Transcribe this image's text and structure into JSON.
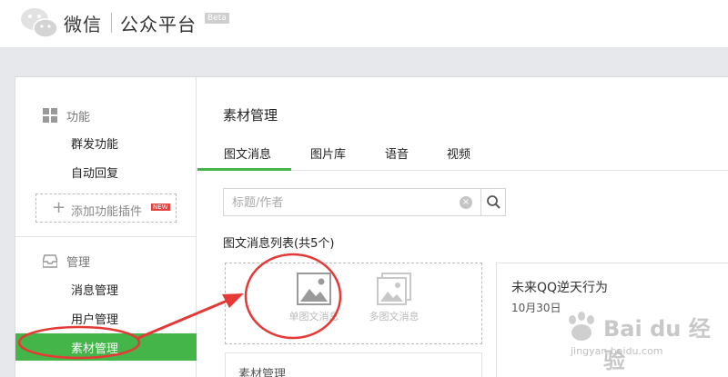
{
  "header": {
    "brand": "微信",
    "product": "公众平台",
    "badge": "Beta"
  },
  "sidebar": {
    "section_function": {
      "title": "功能",
      "icon": "grid-icon",
      "items": [
        "群发功能",
        "自动回复"
      ]
    },
    "add_plugin": {
      "label": "添加功能插件",
      "badge": "NEW"
    },
    "section_manage": {
      "title": "管理",
      "icon": "inbox-icon",
      "items": [
        "消息管理",
        "用户管理",
        "素材管理"
      ],
      "active_index": 2
    }
  },
  "main": {
    "title": "素材管理",
    "tabs": [
      "图文消息",
      "图片库",
      "语音",
      "视频"
    ],
    "active_tab": 0,
    "search": {
      "placeholder": "标题/作者",
      "value": ""
    },
    "list_label": "图文消息列表(共5个)",
    "create_options": [
      {
        "label": "单图文消息",
        "icon": "image-icon"
      },
      {
        "label": "多图文消息",
        "icon": "images-stack-icon"
      }
    ],
    "article": {
      "title": "未来QQ逆天行为",
      "date": "10月30日"
    },
    "second_card_title": "素材管理"
  },
  "colors": {
    "accent": "#44b549",
    "annotation": "#e53935",
    "background": "#e7e8eb"
  },
  "watermark": {
    "logo": "Bai du 经验",
    "url": "jingyan.baidu.com"
  }
}
